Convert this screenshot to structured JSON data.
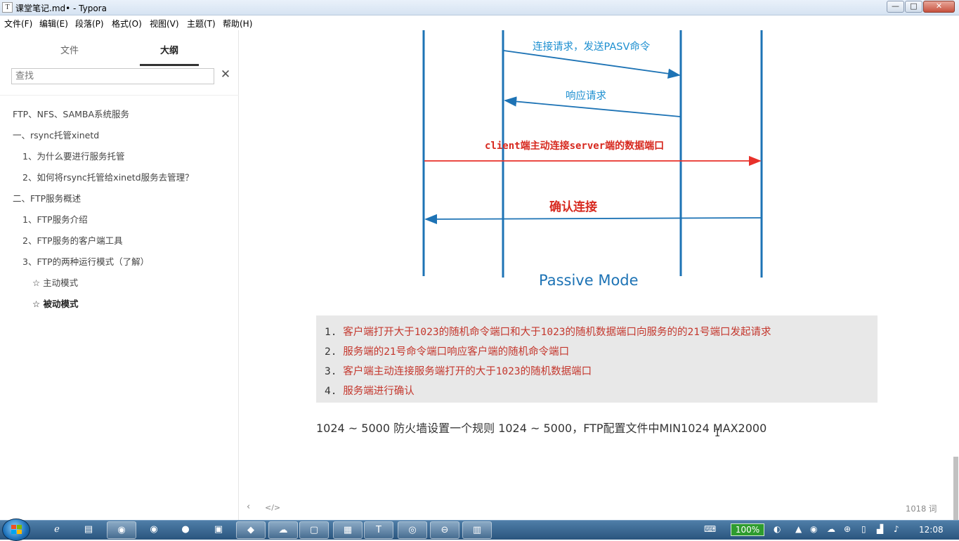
{
  "window": {
    "icon_letter": "T",
    "title": "课堂笔记.md• - Typora",
    "minimize": "—",
    "maximize": "□",
    "close": "✕"
  },
  "menu": [
    "文件(F)",
    "编辑(E)",
    "段落(P)",
    "格式(O)",
    "视图(V)",
    "主题(T)",
    "帮助(H)"
  ],
  "sidebar": {
    "tabs": [
      "文件",
      "大纲"
    ],
    "active_tab": "大纲",
    "search_placeholder": "查找",
    "close_icon": "✕",
    "outline": [
      {
        "label": "FTP、NFS、SAMBA系统服务",
        "level": 1
      },
      {
        "label": "一、rsync托管xinetd",
        "level": 1
      },
      {
        "label": "1、为什么要进行服务托管",
        "level": 2
      },
      {
        "label": "2、如何将rsync托管给xinetd服务去管理？",
        "level": 2
      },
      {
        "label": "二、FTP服务概述",
        "level": 1
      },
      {
        "label": "1、FTP服务介绍",
        "level": 2
      },
      {
        "label": "2、FTP服务的客户端工具",
        "level": 2
      },
      {
        "label": "3、FTP的两种运行模式（了解）",
        "level": 2
      },
      {
        "label": "☆ 主动模式",
        "level": 3
      },
      {
        "label": "☆ 被动模式",
        "level": 3,
        "active": true
      }
    ]
  },
  "diagram": {
    "msg1": "连接请求，发送PASV命令",
    "msg2": "响应请求",
    "msg3": "client端主动连接server端的数据端口",
    "msg4": "确认连接",
    "caption": "Passive Mode",
    "colors": {
      "blue": "#1d73b5",
      "red": "#e8312a",
      "red_text": "#d7291f"
    }
  },
  "steps": [
    {
      "num": "1.",
      "text": "客户端打开大于1023的随机命令端口和大于1023的随机数据端口向服务的的21号端口发起请求"
    },
    {
      "num": "2.",
      "text": "服务端的21号命令端口响应客户端的随机命令端口"
    },
    {
      "num": "3.",
      "text": "客户端主动连接服务端打开的大于1023的随机数据端口"
    },
    {
      "num": "4.",
      "text": "服务端进行确认"
    }
  ],
  "paragraph": "1024 ~ 5000 防火墙设置一个规则 1024 ~ 5000，FTP配置文件中MIN1024  MAX2000",
  "footer": {
    "back_icon": "‹",
    "source_icon": "</>",
    "word_count": "1018 词"
  },
  "taskbar": {
    "zoom": "100%",
    "clock": "12:08"
  }
}
